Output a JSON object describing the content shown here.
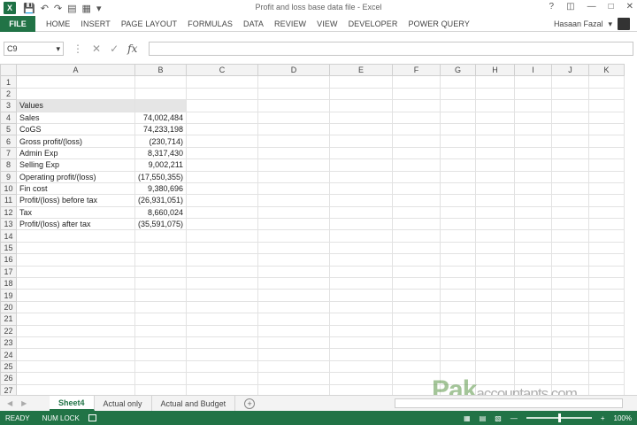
{
  "window": {
    "title": "Profit and loss base data file - Excel",
    "icon": "excel-icon"
  },
  "ribbon": {
    "file": "FILE",
    "tabs": [
      "HOME",
      "INSERT",
      "PAGE LAYOUT",
      "FORMULAS",
      "DATA",
      "REVIEW",
      "VIEW",
      "DEVELOPER",
      "POWER QUERY"
    ],
    "user": "Hasaan Fazal"
  },
  "formula_bar": {
    "name_box": "C9",
    "fx": "fx",
    "value": ""
  },
  "columns": [
    "A",
    "B",
    "C",
    "D",
    "E",
    "F",
    "G",
    "H",
    "I",
    "J",
    "K"
  ],
  "rows": [
    {
      "n": "1",
      "a": "",
      "b": ""
    },
    {
      "n": "2",
      "a": "",
      "b": ""
    },
    {
      "n": "3",
      "a": "Values",
      "b": "",
      "header": true
    },
    {
      "n": "4",
      "a": "Sales",
      "b": "74,002,484"
    },
    {
      "n": "5",
      "a": "CoGS",
      "b": "74,233,198"
    },
    {
      "n": "6",
      "a": "Gross profit/(loss)",
      "b": "(230,714)"
    },
    {
      "n": "7",
      "a": "Admin Exp",
      "b": "8,317,430"
    },
    {
      "n": "8",
      "a": "Selling Exp",
      "b": "9,002,211"
    },
    {
      "n": "9",
      "a": "Operating profit/(loss)",
      "b": "(17,550,355)"
    },
    {
      "n": "10",
      "a": "Fin cost",
      "b": "9,380,696"
    },
    {
      "n": "11",
      "a": "Profit/(loss) before tax",
      "b": "(26,931,051)"
    },
    {
      "n": "12",
      "a": "Tax",
      "b": "8,660,024"
    },
    {
      "n": "13",
      "a": "Profit/(loss) after tax",
      "b": "(35,591,075)"
    },
    {
      "n": "14",
      "a": "",
      "b": ""
    },
    {
      "n": "15",
      "a": "",
      "b": ""
    },
    {
      "n": "16",
      "a": "",
      "b": ""
    },
    {
      "n": "17",
      "a": "",
      "b": ""
    },
    {
      "n": "18",
      "a": "",
      "b": ""
    },
    {
      "n": "19",
      "a": "",
      "b": ""
    },
    {
      "n": "20",
      "a": "",
      "b": ""
    },
    {
      "n": "21",
      "a": "",
      "b": ""
    },
    {
      "n": "22",
      "a": "",
      "b": ""
    },
    {
      "n": "23",
      "a": "",
      "b": ""
    },
    {
      "n": "24",
      "a": "",
      "b": ""
    },
    {
      "n": "25",
      "a": "",
      "b": ""
    },
    {
      "n": "26",
      "a": "",
      "b": ""
    },
    {
      "n": "27",
      "a": "",
      "b": ""
    }
  ],
  "sheet_tabs": [
    "Sheet4",
    "Actual only",
    "Actual and Budget"
  ],
  "active_sheet": "Sheet4",
  "watermark": {
    "brand": "Pak",
    "rest": "accountants.com"
  },
  "status": {
    "ready": "READY",
    "numlock": "NUM LOCK",
    "zoom": "100%"
  },
  "colors": {
    "excel_green": "#217346",
    "header_gray": "#e5e5e5"
  }
}
